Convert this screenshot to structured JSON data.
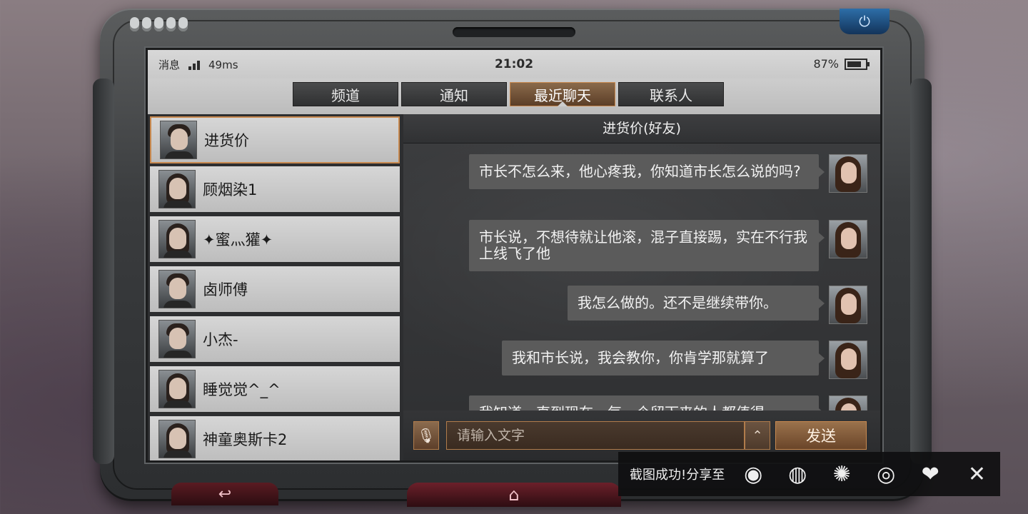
{
  "status_bar": {
    "app_label": "消息",
    "latency": "49ms",
    "time": "21:02",
    "battery": "87%",
    "battery_level": 0.87
  },
  "tabs": [
    {
      "label": "频道",
      "active": false
    },
    {
      "label": "通知",
      "active": false
    },
    {
      "label": "最近聊天",
      "active": true
    },
    {
      "label": "联系人",
      "active": false
    }
  ],
  "contacts": [
    {
      "name": "进货价",
      "selected": true,
      "gender": "male"
    },
    {
      "name": "顾烟染1",
      "selected": false,
      "gender": "female"
    },
    {
      "name": "✦蜜灬獾✦",
      "selected": false,
      "gender": "female"
    },
    {
      "name": "卤师傅",
      "selected": false,
      "gender": "male"
    },
    {
      "name": "小杰-",
      "selected": false,
      "gender": "male"
    },
    {
      "name": "睡觉觉^_^",
      "selected": false,
      "gender": "female"
    },
    {
      "name": "神童奥斯卡2",
      "selected": false,
      "gender": "female"
    }
  ],
  "chat": {
    "title": "进货价(好友)",
    "messages": [
      {
        "text": "市长不怎么来，他心疼我，你知道市长怎么说的吗?"
      },
      {
        "text": "市长说，不想待就让他滚，混子直接踢，实在不行我上线飞了他"
      },
      {
        "text": "我怎么做的。还不是继续带你。"
      },
      {
        "text": "我和市长说，我会教你，你肯学那就算了"
      },
      {
        "text": "我知道，直到现在，每一个留下来的人都值得"
      }
    ],
    "input_placeholder": "请输入文字",
    "send_label": "发送"
  },
  "share_toast": {
    "label": "截图成功!分享至",
    "icons": [
      "weibo-icon",
      "wechat-icon",
      "moments-icon",
      "qq-icon",
      "qzone-icon"
    ]
  },
  "colors": {
    "accent": "#c8894f",
    "bubble": "#5b5b5b",
    "home_red": "#6c202a"
  }
}
